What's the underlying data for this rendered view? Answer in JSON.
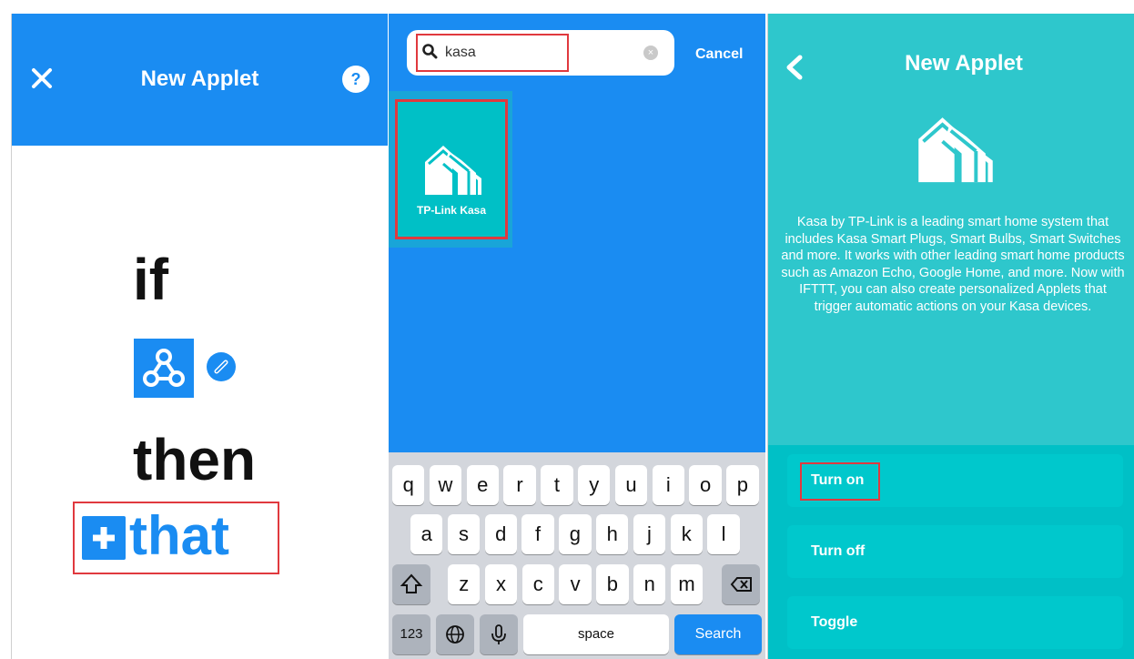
{
  "colors": {
    "ifttt_blue": "#1a8cf2",
    "kasa_teal": "#00c0c6",
    "highlight_red": "#e0393e"
  },
  "panel1": {
    "header_title": "New Applet",
    "close_icon": "close-icon",
    "help_label": "?",
    "if_label": "if",
    "trigger_icon": "webhooks-icon",
    "edit_icon": "pencil-icon",
    "then_label": "then",
    "that_label": "that",
    "add_icon": "plus-icon"
  },
  "panel2": {
    "search": {
      "value": "kasa",
      "clear_icon": "clear-icon",
      "search_icon": "search-icon"
    },
    "cancel_label": "Cancel",
    "result": {
      "label": "TP-Link Kasa",
      "icon": "kasa-logo-icon"
    },
    "keyboard": {
      "row1": [
        "q",
        "w",
        "e",
        "r",
        "t",
        "y",
        "u",
        "i",
        "o",
        "p"
      ],
      "row2": [
        "a",
        "s",
        "d",
        "f",
        "g",
        "h",
        "j",
        "k",
        "l"
      ],
      "row3": [
        "z",
        "x",
        "c",
        "v",
        "b",
        "n",
        "m"
      ],
      "numbers_label": "123",
      "space_label": "space",
      "search_label": "Search"
    }
  },
  "panel3": {
    "title": "New Applet",
    "description": "Kasa by TP-Link is a leading smart home system that includes Kasa Smart Plugs, Smart Bulbs, Smart Switches and more.  It works with other leading smart home products such as Amazon Echo, Google Home, and more. Now with IFTTT, you can also create personalized Applets that trigger automatic actions on your Kasa devices.",
    "actions": [
      "Turn on",
      "Turn off",
      "Toggle"
    ]
  }
}
